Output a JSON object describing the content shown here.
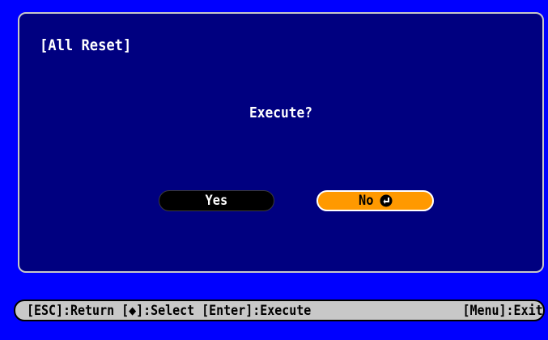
{
  "dialog": {
    "title": "[All Reset]",
    "question": "Execute?",
    "yes_label": "Yes",
    "no_label": "No",
    "selected_option": "No",
    "selected_icon": "enter-icon"
  },
  "statusbar": {
    "left_text": "[ESC]:Return [◆]:Select [Enter]:Execute",
    "right_text": "[Menu]:Exit"
  },
  "colors": {
    "screen_background": "#0000ff",
    "panel_background": "#000080",
    "selected_button": "#ff9900",
    "unselected_button": "#000000",
    "statusbar_background": "#c8c8c8"
  }
}
